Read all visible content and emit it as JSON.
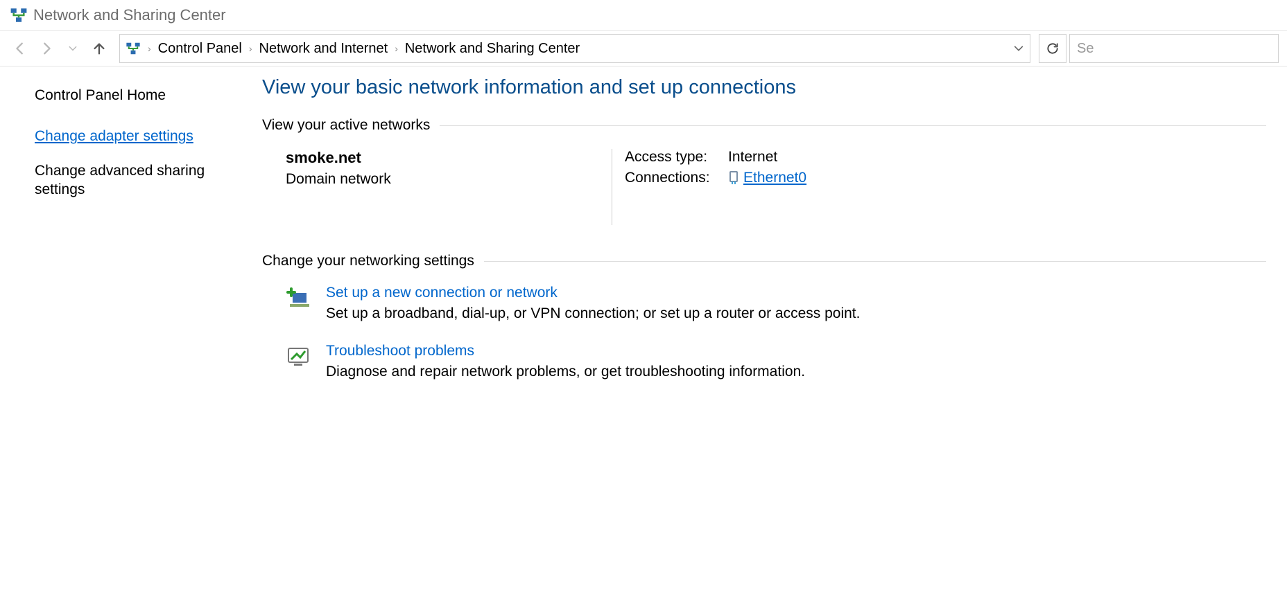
{
  "window": {
    "title": "Network and Sharing Center"
  },
  "breadcrumb": {
    "items": [
      "Control Panel",
      "Network and Internet",
      "Network and Sharing Center"
    ]
  },
  "search": {
    "placeholder": "Se"
  },
  "sidebar": {
    "home": "Control Panel Home",
    "link1": "Change adapter settings",
    "link2": "Change advanced sharing settings"
  },
  "main": {
    "heading": "View your basic network information and set up connections",
    "section_active": "View your active networks",
    "network": {
      "name": "smoke.net",
      "type": "Domain network",
      "access_label": "Access type:",
      "access_value": "Internet",
      "conn_label": "Connections:",
      "conn_value": "Ethernet0"
    },
    "section_change": "Change your networking settings",
    "opt1": {
      "title": "Set up a new connection or network",
      "desc": "Set up a broadband, dial-up, or VPN connection; or set up a router or access point."
    },
    "opt2": {
      "title": "Troubleshoot problems",
      "desc": "Diagnose and repair network problems, or get troubleshooting information."
    }
  }
}
